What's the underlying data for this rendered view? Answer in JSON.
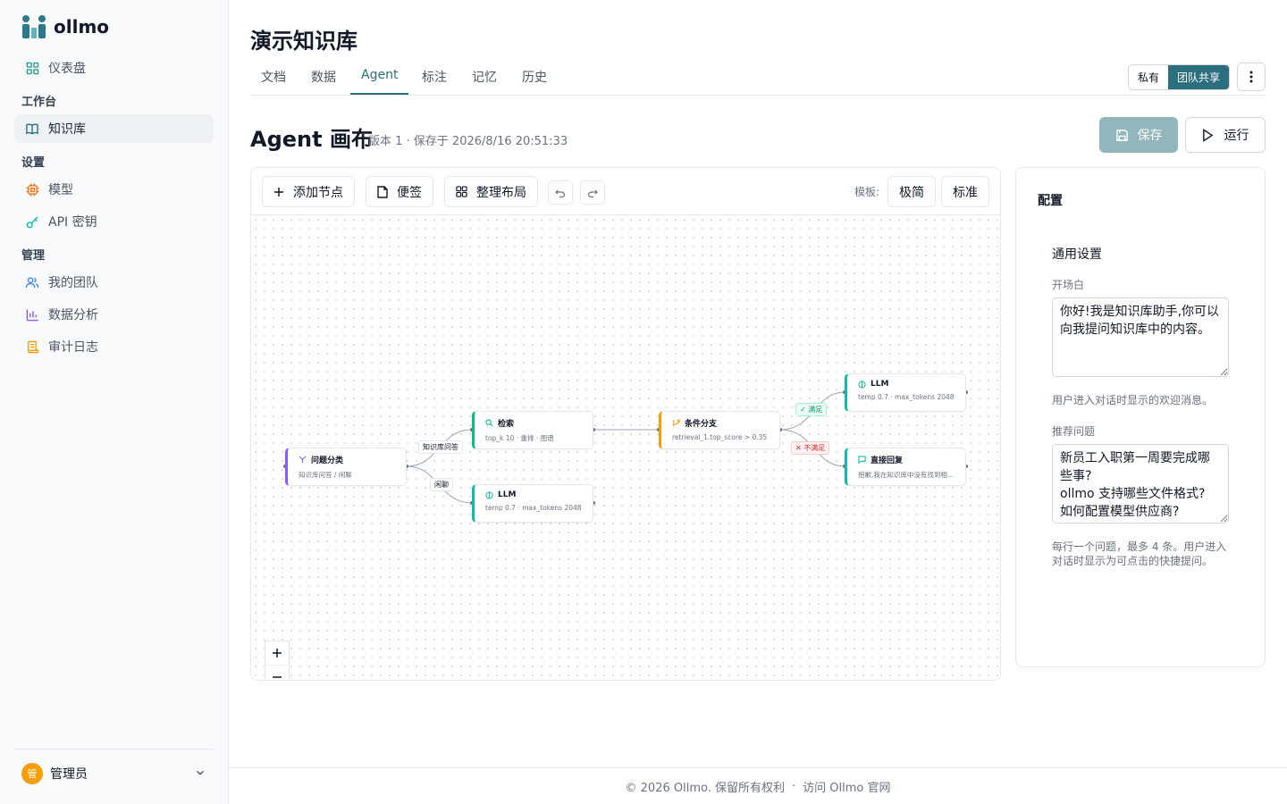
{
  "brand": {
    "name": "ollmo"
  },
  "sidebar": {
    "dashboard": "仪表盘",
    "section_workbench": "工作台",
    "knowledge_base": "知识库",
    "section_settings": "设置",
    "models": "模型",
    "api_keys": "API 密钥",
    "section_admin": "管理",
    "my_team": "我的团队",
    "analytics": "数据分析",
    "audit_log": "审计日志",
    "user_name": "管理员",
    "user_initial": "管"
  },
  "header": {
    "title": "演示知识库",
    "tabs": [
      "文档",
      "数据",
      "Agent",
      "标注",
      "记忆",
      "历史"
    ],
    "active_tab": "Agent",
    "visibility_private": "私有",
    "visibility_team": "团队共享"
  },
  "canvas": {
    "title": "Agent 画布",
    "meta": "版本 1 · 保存于 2026/8/16 20:51:33",
    "save_label": "保存",
    "run_label": "运行",
    "toolbar": {
      "add_node": "添加节点",
      "sticky_note": "便签",
      "tidy_layout": "整理布局",
      "template_label": "模板:",
      "template_minimal": "极简",
      "template_standard": "标准"
    },
    "nodes": {
      "classify": {
        "title": "问题分类",
        "subtitle": "知识库问答 / 闲聊"
      },
      "retrieve": {
        "title": "检索",
        "subtitle": "top_k 10 · 重排 · 图谱"
      },
      "llm_chat": {
        "title": "LLM",
        "subtitle": "temp 0.7 · max_tokens 2048"
      },
      "condition": {
        "title": "条件分支",
        "subtitle": "retrieval_1.top_score > 0.35"
      },
      "llm_answer": {
        "title": "LLM",
        "subtitle": "temp 0.7 · max_tokens 2048"
      },
      "direct_reply": {
        "title": "直接回复",
        "subtitle": "抱歉,我在知识库中没有找到相..."
      }
    },
    "edge_labels": {
      "kb_qa": "知识库问答",
      "chat": "闲聊",
      "pass": "✓ 满足",
      "fail": "✕ 不满足"
    },
    "colors": {
      "classify": "#8b5cf6",
      "retrieve": "#10b981",
      "llm": "#14b8a6",
      "condition": "#f59e0b",
      "reply": "#14b8a6"
    }
  },
  "config": {
    "title": "配置",
    "section": "通用设置",
    "opening_label": "开场白",
    "opening_value": "你好!我是知识库助手,你可以向我提问知识库中的内容。",
    "opening_help": "用户进入对话时显示的欢迎消息。",
    "suggested_label": "推荐问题",
    "suggested_value": "新员工入职第一周要完成哪些事?\nollmo 支持哪些文件格式?\n如何配置模型供应商?",
    "suggested_help": "每行一个问题，最多 4 条。用户进入对话时显示为可点击的快捷提问。"
  },
  "footer": {
    "copyright": "© 2026 Ollmo. 保留所有权利",
    "separator": "·",
    "visit": "访问 Ollmo 官网"
  }
}
